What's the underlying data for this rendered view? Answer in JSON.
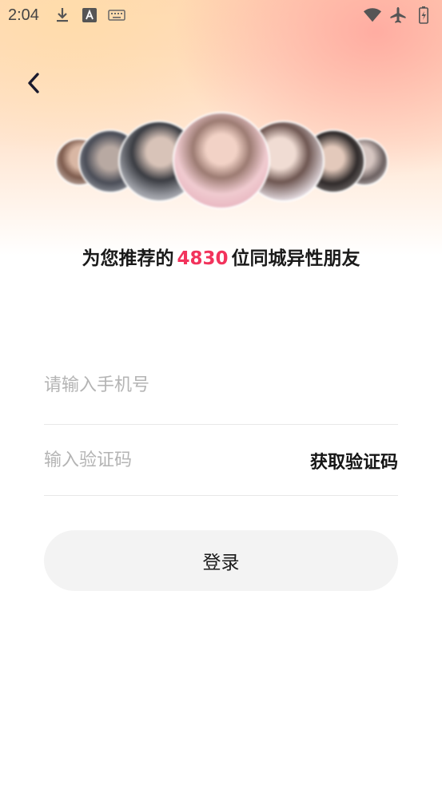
{
  "status_bar": {
    "time": "2:04",
    "left_icons": [
      "download-icon",
      "font-a-icon",
      "keyboard-icon"
    ],
    "right_icons": [
      "wifi-icon",
      "airplane-icon",
      "battery-icon"
    ]
  },
  "header": {
    "back_icon": "chevron-left-icon"
  },
  "headline": {
    "prefix": "为您推荐的",
    "count": "4830",
    "suffix": "位同城异性朋友"
  },
  "form": {
    "phone_placeholder": "请输入手机号",
    "phone_value": "",
    "code_placeholder": "输入验证码",
    "code_value": "",
    "get_code_label": "获取验证码",
    "login_label": "登录"
  },
  "colors": {
    "accent": "#f2335c",
    "button_bg": "#f3f3f3",
    "divider": "#e8e8e8",
    "placeholder": "#b4b4b4"
  }
}
